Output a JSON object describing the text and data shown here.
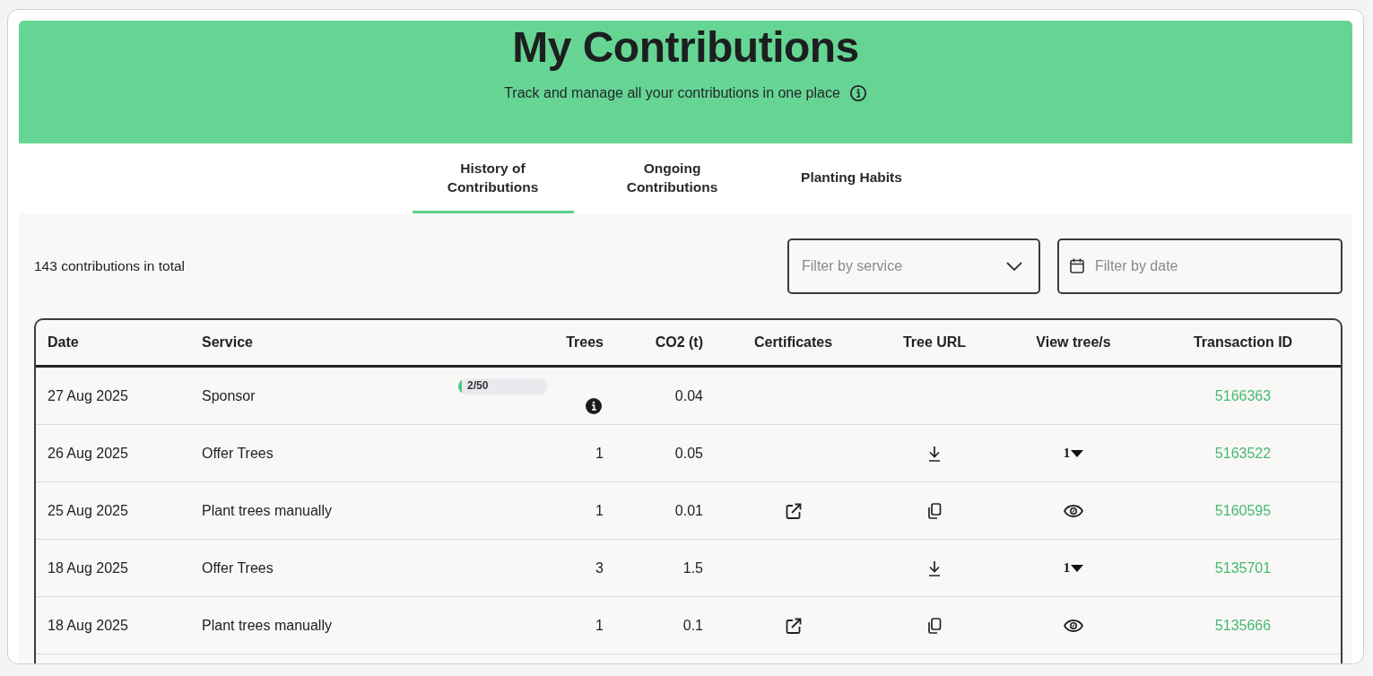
{
  "header": {
    "title": "My Contributions",
    "subtitle": "Track and manage all your contributions in one place"
  },
  "tabs": [
    {
      "label": "History of Contributions",
      "selected": true
    },
    {
      "label": "Ongoing Contributions",
      "selected": false
    },
    {
      "label": "Planting Habits",
      "selected": false
    }
  ],
  "summary": "143 contributions in total",
  "filters": {
    "service": {
      "placeholder": "Filter by service"
    },
    "date": {
      "placeholder": "Filter by date"
    }
  },
  "table": {
    "columns": [
      "Date",
      "Service",
      "Trees",
      "CO2 (t)",
      "Certificates",
      "Tree URL",
      "View tree/s",
      "Transaction ID"
    ],
    "rows": [
      {
        "date": "27 Aug 2025",
        "service": "Sponsor",
        "trees": {
          "kind": "progress",
          "label": "2/50",
          "level": 0.04
        },
        "co2": "0.04",
        "certificate": false,
        "view": {
          "kind": "none"
        },
        "transaction_id": "5166363"
      },
      {
        "date": "26 Aug 2025",
        "service": "Offer Trees",
        "trees": {
          "kind": "number",
          "text": "1"
        },
        "co2": "0.05",
        "certificate": false,
        "tree_url": {
          "kind": "download"
        },
        "view": {
          "kind": "count",
          "text": "1"
        },
        "transaction_id": "5163522"
      },
      {
        "date": "25 Aug 2025",
        "service": "Plant trees manually",
        "trees": {
          "kind": "number",
          "text": "1"
        },
        "co2": "0.01",
        "certificate": true,
        "tree_url": {
          "kind": "copy"
        },
        "view": {
          "kind": "eye"
        },
        "transaction_id": "5160595"
      },
      {
        "date": "18 Aug 2025",
        "service": "Offer Trees",
        "trees": {
          "kind": "number",
          "text": "3"
        },
        "co2": "1.5",
        "certificate": false,
        "tree_url": {
          "kind": "download"
        },
        "view": {
          "kind": "count",
          "text": "1"
        },
        "transaction_id": "5135701"
      },
      {
        "date": "18 Aug 2025",
        "service": "Plant trees manually",
        "trees": {
          "kind": "number",
          "text": "1"
        },
        "co2": "0.1",
        "certificate": true,
        "tree_url": {
          "kind": "copy"
        },
        "view": {
          "kind": "eye"
        },
        "transaction_id": "5135666"
      }
    ]
  }
}
